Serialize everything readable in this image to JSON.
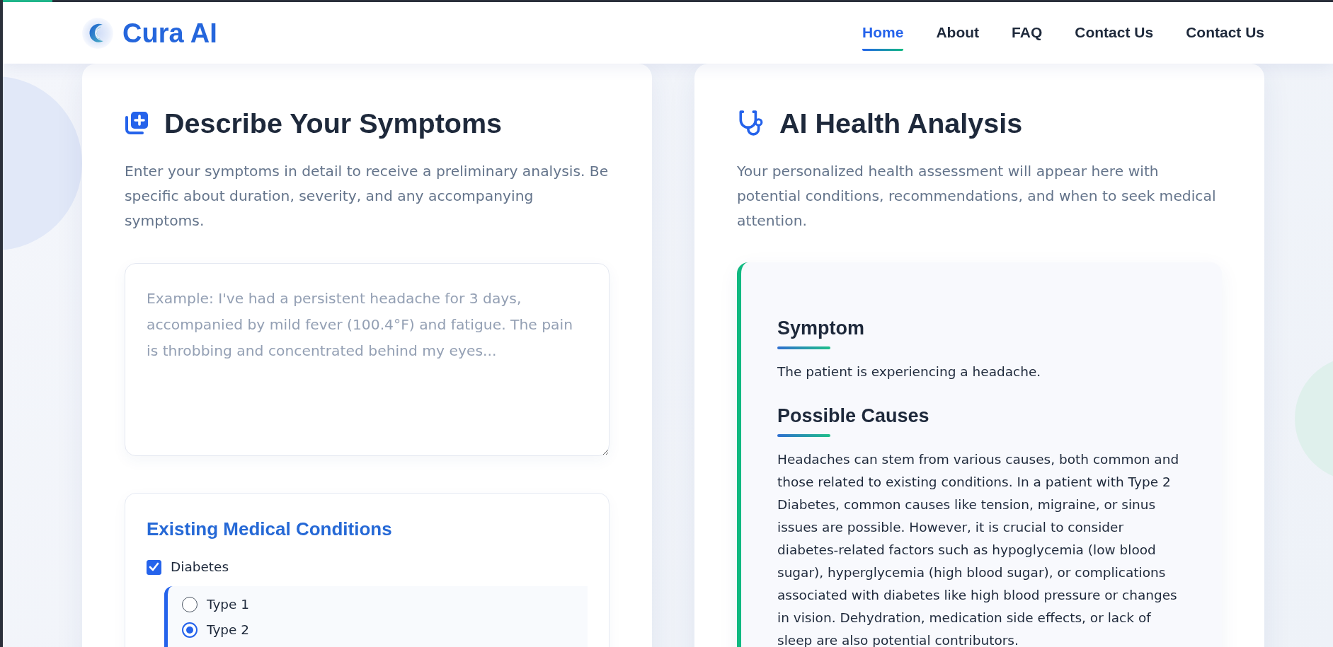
{
  "header": {
    "logo": "Cura AI",
    "nav": [
      {
        "label": "Home",
        "selected": true
      },
      {
        "label": "About",
        "selected": false
      },
      {
        "label": "FAQ",
        "selected": false
      },
      {
        "label": "Contact Us",
        "selected": false
      },
      {
        "label": "Contact Us",
        "selected": false
      }
    ]
  },
  "symptom_panel": {
    "title": "Describe Your Symptoms",
    "description": "Enter your symptoms in detail to receive a preliminary analysis. Be specific about duration, severity, and any accompanying symptoms.",
    "symptom_input": {
      "placeholder": "Example: I've had a persistent headache for 3 days, accompanied by mild fever (100.4°F) and fatigue. The pain is throbbing and concentrated behind my eyes..."
    },
    "conditions": {
      "title": "Existing Medical Conditions",
      "items": [
        {
          "label": "Diabetes",
          "checked": true,
          "options": [
            {
              "label": "Type 1",
              "selected": false
            },
            {
              "label": "Type 2",
              "selected": true
            }
          ]
        }
      ]
    }
  },
  "analysis_panel": {
    "title": "AI Health Analysis",
    "description": "Your personalized health assessment will appear here with potential conditions, recommendations, and when to seek medical attention.",
    "sections": [
      {
        "heading": "Symptom",
        "text": "The patient is experiencing a headache."
      },
      {
        "heading": "Possible Causes",
        "text": "Headaches can stem from various causes, both common and those related to existing conditions. In a patient with Type 2 Diabetes, common causes like tension, migraine, or sinus issues are possible. However, it is crucial to consider diabetes-related factors such as hypoglycemia (low blood sugar), hyperglycemia (high blood sugar), or complications associated with diabetes like high blood pressure or changes in vision. Dehydration, medication side effects, or lack of sleep are also potential contributors."
      }
    ]
  }
}
